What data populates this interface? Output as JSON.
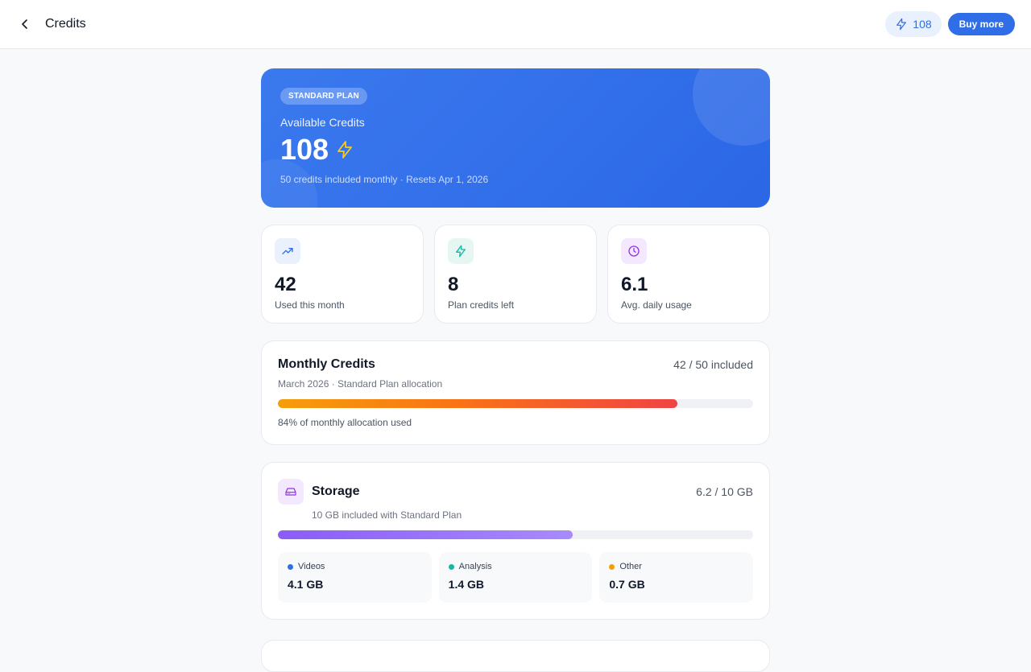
{
  "header": {
    "title": "Credits",
    "balance": "108",
    "buy_label": "Buy more"
  },
  "hero": {
    "plan_badge": "STANDARD PLAN",
    "label": "Available Credits",
    "amount": "108",
    "note": "50 credits included monthly · Resets Apr 1, 2026"
  },
  "stats": [
    {
      "value": "42",
      "label": "Used this month",
      "icon": "trending-up-icon"
    },
    {
      "value": "8",
      "label": "Plan credits left",
      "icon": "lightning-icon"
    },
    {
      "value": "6.1",
      "label": "Avg. daily usage",
      "icon": "clock-icon"
    }
  ],
  "monthly": {
    "title": "Monthly Credits",
    "meta": "42 / 50 included",
    "subtitle": "March 2026 · Standard Plan allocation",
    "progress": 0.84,
    "caption": "84% of monthly allocation used"
  },
  "storage": {
    "title": "Storage",
    "meta": "6.2 / 10 GB",
    "subtitle": "10 GB included with Standard Plan",
    "progress": 0.62,
    "segments": [
      {
        "label": "Videos",
        "value": "4.1 GB",
        "color": "#2f6ee6"
      },
      {
        "label": "Analysis",
        "value": "1.4 GB",
        "color": "#14b8a6"
      },
      {
        "label": "Other",
        "value": "0.7 GB",
        "color": "#f59e0b"
      }
    ]
  },
  "colors": {
    "accent": "#2f6ee6",
    "hero_bg": "#3b79ee",
    "bolt_yellow": "#facc15"
  }
}
